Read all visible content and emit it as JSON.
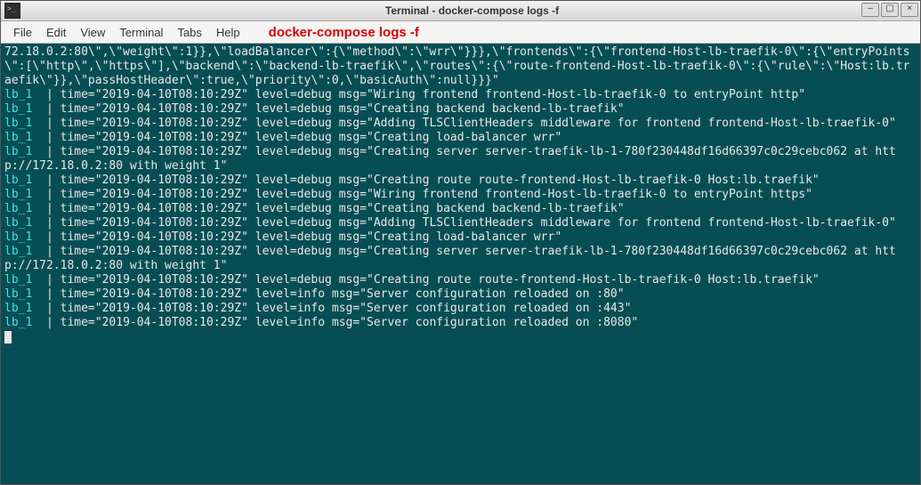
{
  "titlebar": {
    "title": "Terminal - docker-compose logs -f",
    "min": "–",
    "max": "▢",
    "close": "×"
  },
  "menubar": {
    "file": "File",
    "edit": "Edit",
    "view": "View",
    "terminal": "Terminal",
    "tabs": "Tabs",
    "help": "Help",
    "annotation": "docker-compose logs -f"
  },
  "svc": "lb_1",
  "sep": "  | ",
  "lines": [
    {
      "raw": "72.18.0.2:80\\\",\\\"weight\\\":1}},\\\"loadBalancer\\\":{\\\"method\\\":\\\"wrr\\\"}}},\\\"frontends\\\":{\\\"frontend-Host-lb-traefik-0\\\":{\\\"entryPoints\\\":[\\\"http\\\",\\\"https\\\"],\\\"backend\\\":\\\"backend-lb-traefik\\\",\\\"routes\\\":{\\\"route-frontend-Host-lb-traefik-0\\\":{\\\"rule\\\":\\\"Host:lb.traefik\\\"}},\\\"passHostHeader\\\":true,\\\"priority\\\":0,\\\"basicAuth\\\":null}}}\""
    },
    {
      "svc": true,
      "msg": "time=\"2019-04-10T08:10:29Z\" level=debug msg=\"Wiring frontend frontend-Host-lb-traefik-0 to entryPoint http\""
    },
    {
      "svc": true,
      "msg": "time=\"2019-04-10T08:10:29Z\" level=debug msg=\"Creating backend backend-lb-traefik\""
    },
    {
      "svc": true,
      "msg": "time=\"2019-04-10T08:10:29Z\" level=debug msg=\"Adding TLSClientHeaders middleware for frontend frontend-Host-lb-traefik-0\""
    },
    {
      "svc": true,
      "msg": "time=\"2019-04-10T08:10:29Z\" level=debug msg=\"Creating load-balancer wrr\""
    },
    {
      "svc": true,
      "msg": "time=\"2019-04-10T08:10:29Z\" level=debug msg=\"Creating server server-traefik-lb-1-780f230448df16d66397c0c29cebc062 at http://172.18.0.2:80 with weight 1\""
    },
    {
      "svc": true,
      "msg": "time=\"2019-04-10T08:10:29Z\" level=debug msg=\"Creating route route-frontend-Host-lb-traefik-0 Host:lb.traefik\""
    },
    {
      "svc": true,
      "msg": "time=\"2019-04-10T08:10:29Z\" level=debug msg=\"Wiring frontend frontend-Host-lb-traefik-0 to entryPoint https\""
    },
    {
      "svc": true,
      "msg": "time=\"2019-04-10T08:10:29Z\" level=debug msg=\"Creating backend backend-lb-traefik\""
    },
    {
      "svc": true,
      "msg": "time=\"2019-04-10T08:10:29Z\" level=debug msg=\"Adding TLSClientHeaders middleware for frontend frontend-Host-lb-traefik-0\""
    },
    {
      "svc": true,
      "msg": "time=\"2019-04-10T08:10:29Z\" level=debug msg=\"Creating load-balancer wrr\""
    },
    {
      "svc": true,
      "msg": "time=\"2019-04-10T08:10:29Z\" level=debug msg=\"Creating server server-traefik-lb-1-780f230448df16d66397c0c29cebc062 at http://172.18.0.2:80 with weight 1\""
    },
    {
      "svc": true,
      "msg": "time=\"2019-04-10T08:10:29Z\" level=debug msg=\"Creating route route-frontend-Host-lb-traefik-0 Host:lb.traefik\""
    },
    {
      "svc": true,
      "msg": "time=\"2019-04-10T08:10:29Z\" level=info msg=\"Server configuration reloaded on :80\""
    },
    {
      "svc": true,
      "msg": "time=\"2019-04-10T08:10:29Z\" level=info msg=\"Server configuration reloaded on :443\""
    },
    {
      "svc": true,
      "msg": "time=\"2019-04-10T08:10:29Z\" level=info msg=\"Server configuration reloaded on :8080\""
    }
  ]
}
